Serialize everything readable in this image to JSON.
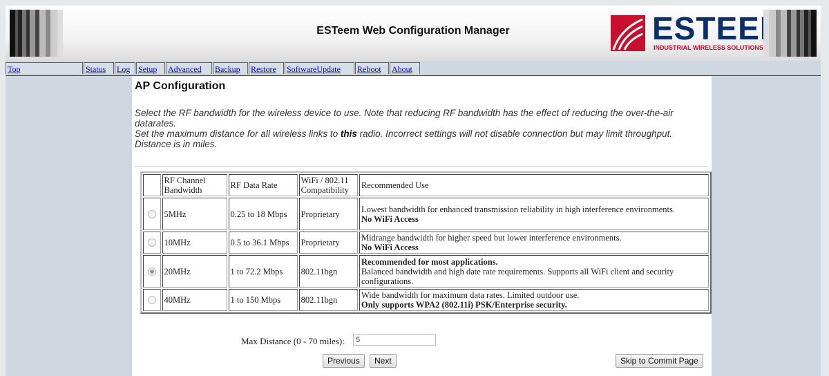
{
  "header": {
    "title": "ESTeem Web Configuration Manager",
    "logo_text": "ESTEEM",
    "logo_subtitle": "INDUSTRIAL WIRELESS SOLUTIONS"
  },
  "nav": {
    "items": [
      {
        "label": "Top"
      },
      {
        "label": "Status"
      },
      {
        "label": "Log"
      },
      {
        "label": "Setup"
      },
      {
        "label": "Advanced"
      },
      {
        "label": "Backup"
      },
      {
        "label": "Restore"
      },
      {
        "label": "SoftwareUpdate"
      },
      {
        "label": "Reboot"
      },
      {
        "label": "About"
      }
    ]
  },
  "main": {
    "title": "AP Configuration",
    "desc_line1": "Select the RF bandwidth for the wireless device to use. Note that reducing RF bandwidth has the effect of reducing the over-the-air datarates.",
    "desc_line2_pre": "Set the maximum distance for all wireless links to ",
    "desc_line2_bold": "this",
    "desc_line2_post": " radio. Incorrect settings will not disable connection but may limit throughput. Distance is in miles.",
    "table": {
      "headers": [
        "RF Channel Bandwidth",
        "RF Data Rate",
        "WiFi / 802.11 Compatibility",
        "Recommended Use"
      ],
      "rows": [
        {
          "bandwidth": "5MHz",
          "rate": "0.25 to 18 Mbps",
          "compat": "Proprietary",
          "use_pre_bold": "",
          "use_text": "Lowest bandwidth for enhanced transmission reliability in high interference environments.",
          "use_bold": "No WiFi Access",
          "selected": false
        },
        {
          "bandwidth": "10MHz",
          "rate": "0.5 to 36.1 Mbps",
          "compat": "Proprietary",
          "use_pre_bold": "",
          "use_text": "Midrange bandwidth for higher speed but lower interference environments.",
          "use_bold": "No WiFi Access",
          "selected": false
        },
        {
          "bandwidth": "20MHz",
          "rate": "1 to 72.2 Mbps",
          "compat": "802.11bgn",
          "use_pre_bold": "Recommended for most applications.",
          "use_text": "Balanced bandwidth and high date rate requirements. Supports all WiFi client and security configurations.",
          "use_bold": "",
          "selected": true
        },
        {
          "bandwidth": "40MHz",
          "rate": "1 to 150 Mbps",
          "compat": "802.11bgn",
          "use_pre_bold": "",
          "use_text": "Wide bandwidth for maximum data rates. Limited outdoor use.",
          "use_bold": "Only supports WPA2 (802.11i) PSK/Enterprise security.",
          "selected": false
        }
      ]
    },
    "max_distance_label": "Max Distance (0 - 70 miles):",
    "max_distance_value": "5",
    "previous_label": "Previous",
    "next_label": "Next",
    "skip_label": "Skip to Commit Page"
  }
}
